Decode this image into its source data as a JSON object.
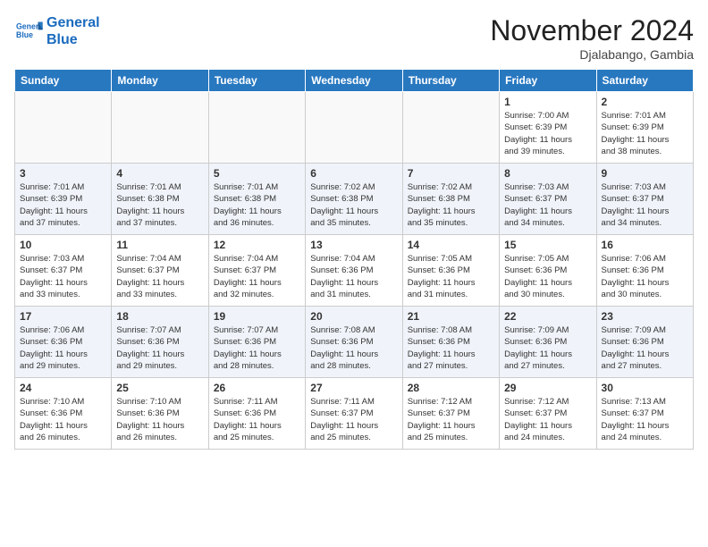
{
  "header": {
    "logo_line1": "General",
    "logo_line2": "Blue",
    "month_title": "November 2024",
    "location": "Djalabango, Gambia"
  },
  "weekdays": [
    "Sunday",
    "Monday",
    "Tuesday",
    "Wednesday",
    "Thursday",
    "Friday",
    "Saturday"
  ],
  "weeks": [
    {
      "alt": false,
      "days": [
        {
          "num": "",
          "info": ""
        },
        {
          "num": "",
          "info": ""
        },
        {
          "num": "",
          "info": ""
        },
        {
          "num": "",
          "info": ""
        },
        {
          "num": "",
          "info": ""
        },
        {
          "num": "1",
          "info": "Sunrise: 7:00 AM\nSunset: 6:39 PM\nDaylight: 11 hours\nand 39 minutes."
        },
        {
          "num": "2",
          "info": "Sunrise: 7:01 AM\nSunset: 6:39 PM\nDaylight: 11 hours\nand 38 minutes."
        }
      ]
    },
    {
      "alt": true,
      "days": [
        {
          "num": "3",
          "info": "Sunrise: 7:01 AM\nSunset: 6:39 PM\nDaylight: 11 hours\nand 37 minutes."
        },
        {
          "num": "4",
          "info": "Sunrise: 7:01 AM\nSunset: 6:38 PM\nDaylight: 11 hours\nand 37 minutes."
        },
        {
          "num": "5",
          "info": "Sunrise: 7:01 AM\nSunset: 6:38 PM\nDaylight: 11 hours\nand 36 minutes."
        },
        {
          "num": "6",
          "info": "Sunrise: 7:02 AM\nSunset: 6:38 PM\nDaylight: 11 hours\nand 35 minutes."
        },
        {
          "num": "7",
          "info": "Sunrise: 7:02 AM\nSunset: 6:38 PM\nDaylight: 11 hours\nand 35 minutes."
        },
        {
          "num": "8",
          "info": "Sunrise: 7:03 AM\nSunset: 6:37 PM\nDaylight: 11 hours\nand 34 minutes."
        },
        {
          "num": "9",
          "info": "Sunrise: 7:03 AM\nSunset: 6:37 PM\nDaylight: 11 hours\nand 34 minutes."
        }
      ]
    },
    {
      "alt": false,
      "days": [
        {
          "num": "10",
          "info": "Sunrise: 7:03 AM\nSunset: 6:37 PM\nDaylight: 11 hours\nand 33 minutes."
        },
        {
          "num": "11",
          "info": "Sunrise: 7:04 AM\nSunset: 6:37 PM\nDaylight: 11 hours\nand 33 minutes."
        },
        {
          "num": "12",
          "info": "Sunrise: 7:04 AM\nSunset: 6:37 PM\nDaylight: 11 hours\nand 32 minutes."
        },
        {
          "num": "13",
          "info": "Sunrise: 7:04 AM\nSunset: 6:36 PM\nDaylight: 11 hours\nand 31 minutes."
        },
        {
          "num": "14",
          "info": "Sunrise: 7:05 AM\nSunset: 6:36 PM\nDaylight: 11 hours\nand 31 minutes."
        },
        {
          "num": "15",
          "info": "Sunrise: 7:05 AM\nSunset: 6:36 PM\nDaylight: 11 hours\nand 30 minutes."
        },
        {
          "num": "16",
          "info": "Sunrise: 7:06 AM\nSunset: 6:36 PM\nDaylight: 11 hours\nand 30 minutes."
        }
      ]
    },
    {
      "alt": true,
      "days": [
        {
          "num": "17",
          "info": "Sunrise: 7:06 AM\nSunset: 6:36 PM\nDaylight: 11 hours\nand 29 minutes."
        },
        {
          "num": "18",
          "info": "Sunrise: 7:07 AM\nSunset: 6:36 PM\nDaylight: 11 hours\nand 29 minutes."
        },
        {
          "num": "19",
          "info": "Sunrise: 7:07 AM\nSunset: 6:36 PM\nDaylight: 11 hours\nand 28 minutes."
        },
        {
          "num": "20",
          "info": "Sunrise: 7:08 AM\nSunset: 6:36 PM\nDaylight: 11 hours\nand 28 minutes."
        },
        {
          "num": "21",
          "info": "Sunrise: 7:08 AM\nSunset: 6:36 PM\nDaylight: 11 hours\nand 27 minutes."
        },
        {
          "num": "22",
          "info": "Sunrise: 7:09 AM\nSunset: 6:36 PM\nDaylight: 11 hours\nand 27 minutes."
        },
        {
          "num": "23",
          "info": "Sunrise: 7:09 AM\nSunset: 6:36 PM\nDaylight: 11 hours\nand 27 minutes."
        }
      ]
    },
    {
      "alt": false,
      "days": [
        {
          "num": "24",
          "info": "Sunrise: 7:10 AM\nSunset: 6:36 PM\nDaylight: 11 hours\nand 26 minutes."
        },
        {
          "num": "25",
          "info": "Sunrise: 7:10 AM\nSunset: 6:36 PM\nDaylight: 11 hours\nand 26 minutes."
        },
        {
          "num": "26",
          "info": "Sunrise: 7:11 AM\nSunset: 6:36 PM\nDaylight: 11 hours\nand 25 minutes."
        },
        {
          "num": "27",
          "info": "Sunrise: 7:11 AM\nSunset: 6:37 PM\nDaylight: 11 hours\nand 25 minutes."
        },
        {
          "num": "28",
          "info": "Sunrise: 7:12 AM\nSunset: 6:37 PM\nDaylight: 11 hours\nand 25 minutes."
        },
        {
          "num": "29",
          "info": "Sunrise: 7:12 AM\nSunset: 6:37 PM\nDaylight: 11 hours\nand 24 minutes."
        },
        {
          "num": "30",
          "info": "Sunrise: 7:13 AM\nSunset: 6:37 PM\nDaylight: 11 hours\nand 24 minutes."
        }
      ]
    }
  ]
}
